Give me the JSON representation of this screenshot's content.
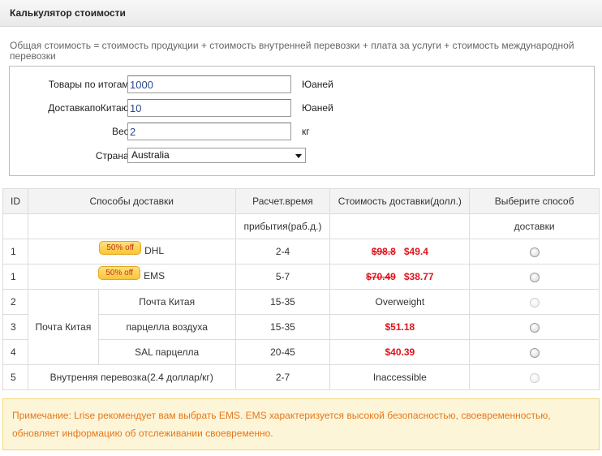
{
  "header": {
    "title": "Калькулятор стоимости"
  },
  "formula": "Общая стоимость = стоимость продукции + стоимость внутренней перевозки + плата за услуги + стоимость международной перевозки",
  "form": {
    "goods_label": "Товары по итогам:",
    "goods_value": "1000",
    "goods_unit": "Юаней",
    "delivery_label": "ДоставкапоКитаю:",
    "delivery_value": "10",
    "delivery_unit": "Юаней",
    "weight_label": "Вес:",
    "weight_value": "2",
    "weight_unit": "кг",
    "country_label": "Страна:",
    "country_value": "Australia"
  },
  "table": {
    "headers": {
      "id": "ID",
      "method": "Способы доставки",
      "time_top": "Расчет.время",
      "time_bottom": "прибытия(раб.д.)",
      "cost": "Стоимость доставки(долл.)",
      "choose_top": "Выберите способ",
      "choose_bottom": "доставки"
    },
    "rows": [
      {
        "id": "1",
        "badge": "50% off",
        "method": "DHL",
        "time": "2-4",
        "old_price": "$98.8",
        "price": "$49.4",
        "radio_enabled": true
      },
      {
        "id": "1",
        "badge": "50% off",
        "method": "EMS",
        "time": "5-7",
        "old_price": "$70.49",
        "price": "$38.77",
        "radio_enabled": true
      },
      {
        "id": "2",
        "group": "Почта Китая",
        "method": "Почта Китая",
        "time": "15-35",
        "status": "Overweight",
        "radio_enabled": false
      },
      {
        "id": "3",
        "method": "парцелла воздуха",
        "time": "15-35",
        "price": "$51.18",
        "radio_enabled": true
      },
      {
        "id": "4",
        "method": "SAL парцелла",
        "time": "20-45",
        "price": "$40.39",
        "radio_enabled": true
      },
      {
        "id": "5",
        "method": "Внутреняя перевозка(2.4 доллар/кг)",
        "time": "2-7",
        "status": "Inaccessible",
        "radio_enabled": false
      }
    ]
  },
  "note": "Примечание: Lrise рекомендует вам выбрать EMS. EMS характеризуется высокой безопасностью, своевременностью, обновляет информацию об отслеживании своевременно.",
  "colors": {
    "price_red": "#e0131b",
    "note_text": "#e6771a",
    "note_bg": "#fdf5d8",
    "badge_bg": "#f9c53a"
  }
}
